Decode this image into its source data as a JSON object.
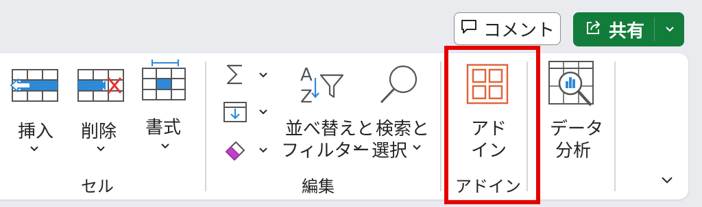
{
  "header": {
    "comment_label": "コメント",
    "share_label": "共有"
  },
  "ribbon": {
    "cells": {
      "insert": "挿入",
      "delete": "削除",
      "format": "書式",
      "group_label": "セル"
    },
    "editing": {
      "sort_filter_line1": "並べ替えと",
      "sort_filter_line2": "フィルター",
      "find_select_line1": "検索と",
      "find_select_line2": "選択",
      "group_label": "編集"
    },
    "addins": {
      "addins_line1": "アド",
      "addins_line2": "イン",
      "group_label": "アドイン"
    },
    "analysis": {
      "data_analysis_line1": "データ",
      "data_analysis_line2": "分析"
    }
  },
  "colors": {
    "share_green": "#127d3a",
    "accent_blue": "#2e8ad8",
    "addin_orange": "#e0643a",
    "highlight_red": "#e60000",
    "eraser_purple": "#c040c8"
  }
}
